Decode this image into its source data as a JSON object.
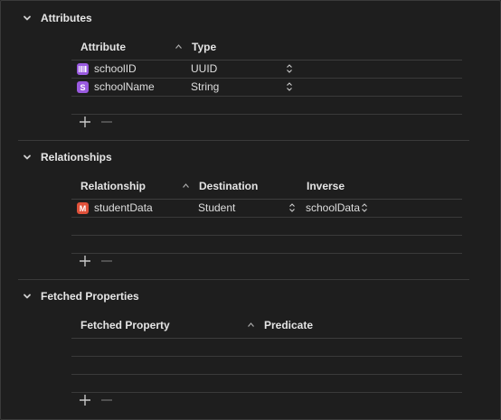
{
  "attributes": {
    "title": "Attributes",
    "columns": [
      "Attribute",
      "Type"
    ],
    "rows": [
      {
        "icon": "attribute-uuid-icon",
        "name": "schoolID",
        "type": "UUID"
      },
      {
        "icon": "attribute-string-icon",
        "badge": "S",
        "name": "schoolName",
        "type": "String"
      }
    ]
  },
  "relationships": {
    "title": "Relationships",
    "columns": [
      "Relationship",
      "Destination",
      "Inverse"
    ],
    "rows": [
      {
        "badge": "M",
        "name": "studentData",
        "destination": "Student",
        "inverse": "schoolData"
      }
    ]
  },
  "fetched": {
    "title": "Fetched Properties",
    "columns": [
      "Fetched Property",
      "Predicate"
    ]
  },
  "colors": {
    "purple": "#9a5ae0",
    "red": "#e0513a",
    "background": "#1e1e1e"
  }
}
